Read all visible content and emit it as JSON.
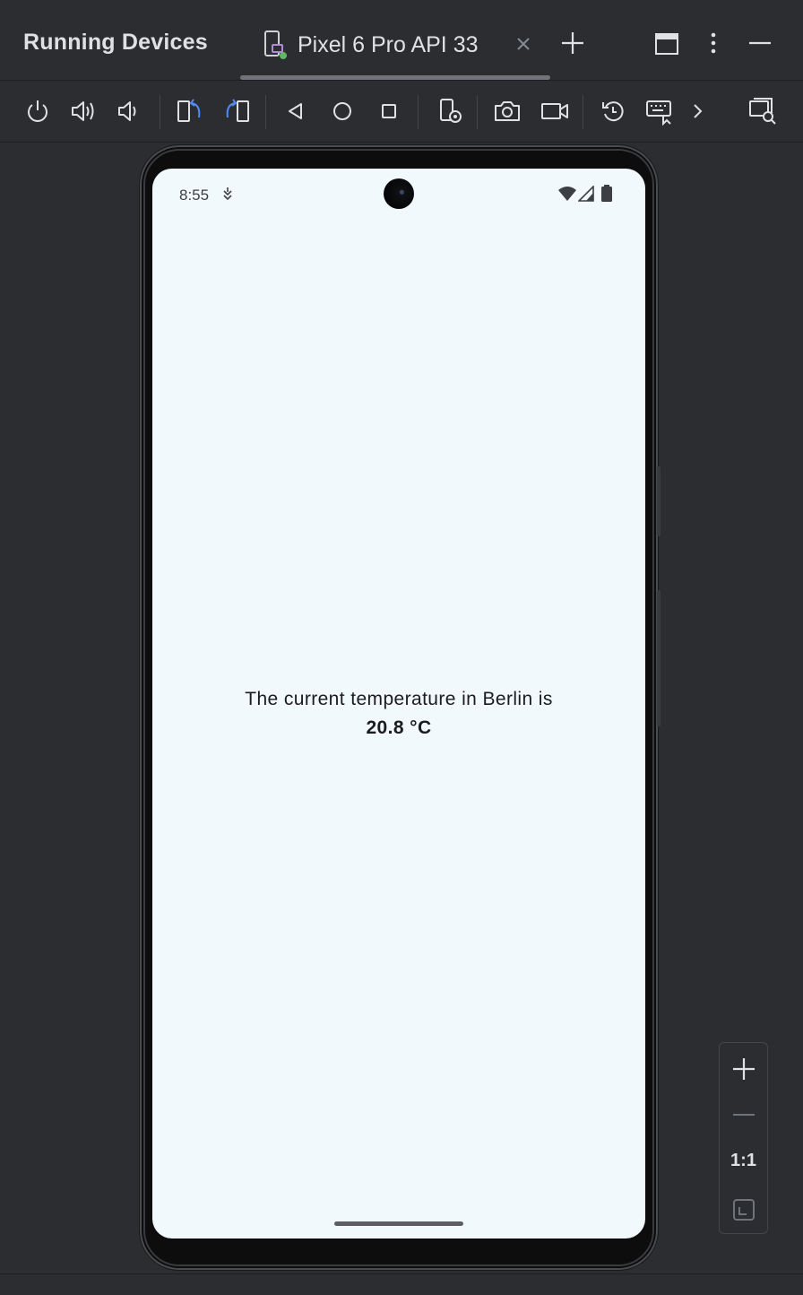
{
  "panel": {
    "title": "Running Devices"
  },
  "tab": {
    "label": "Pixel 6 Pro API 33"
  },
  "toolbar": {
    "icons": [
      "power-icon",
      "volume-up-icon",
      "volume-down-icon",
      "rotate-left-icon",
      "rotate-right-icon",
      "back-icon",
      "home-icon",
      "overview-icon",
      "device-settings-icon",
      "screenshot-icon",
      "screen-record-icon",
      "reset-icon",
      "keyboard-icon",
      "more-actions-chevron-icon",
      "device-explorer-icon"
    ]
  },
  "device": {
    "status_time": "8:55",
    "message": "The current temperature in Berlin is",
    "temperature": "20.8 °C"
  },
  "zoom": {
    "actual_size_label": "1:1"
  },
  "colors": {
    "accent_blue": "#548af7",
    "screen_bg": "#f2f9fd",
    "ide_bg": "#2b2d30"
  }
}
